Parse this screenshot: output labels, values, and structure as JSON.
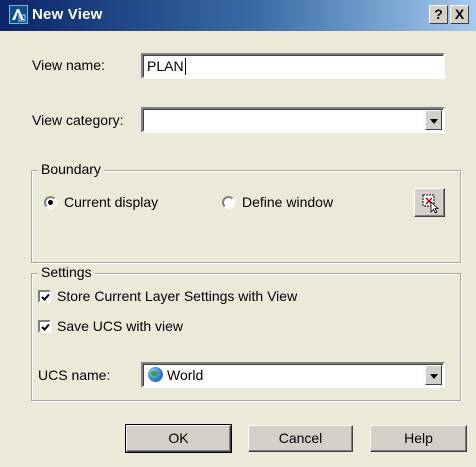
{
  "window": {
    "title": "New View",
    "help_label": "?",
    "close_label": "X"
  },
  "form": {
    "view_name_label": "View name:",
    "view_name_value": "PLAN",
    "view_category_label": "View category:",
    "view_category_value": ""
  },
  "boundary": {
    "title": "Boundary",
    "current_display_label": "Current display",
    "define_window_label": "Define window",
    "selected": "current_display"
  },
  "settings": {
    "title": "Settings",
    "store_layer_label": "Store Current Layer Settings with View",
    "store_layer_checked": true,
    "save_ucs_label": "Save UCS with view",
    "save_ucs_checked": true,
    "ucs_name_label": "UCS name:",
    "ucs_name_value": "World"
  },
  "buttons": {
    "ok": "OK",
    "cancel": "Cancel",
    "help": "Help"
  },
  "icons": {
    "app": "autocad-icon",
    "ucs": "globe-icon",
    "define_window": "window-pick-icon"
  }
}
